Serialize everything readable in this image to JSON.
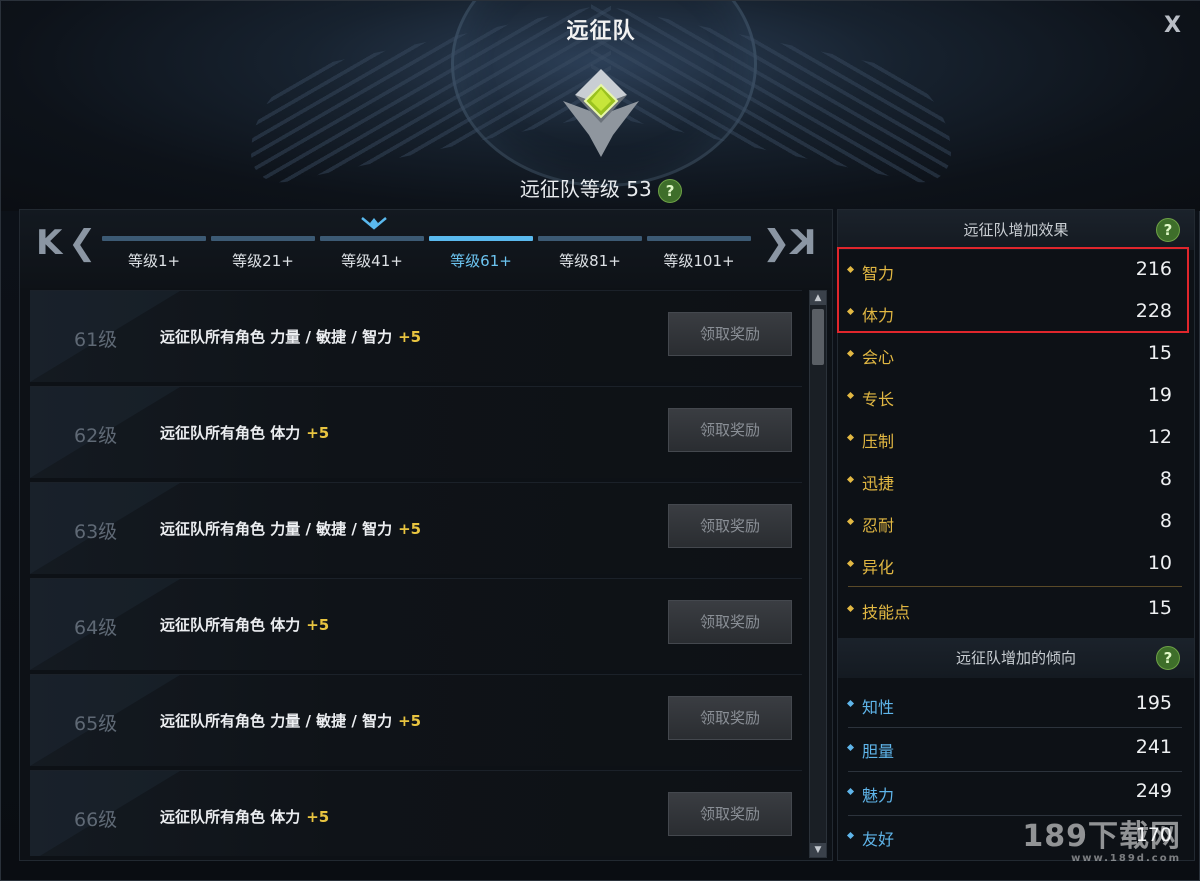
{
  "window": {
    "title": "远征队",
    "close_label": "X"
  },
  "expedition": {
    "level_label": "远征队等级 53",
    "help": "?"
  },
  "tabs": {
    "first": "K",
    "prev": "❮",
    "next": "❯",
    "last": "K",
    "items": [
      {
        "label": "等级1+",
        "active": false
      },
      {
        "label": "等级21+",
        "active": false
      },
      {
        "label": "等级41+",
        "active": false
      },
      {
        "label": "等级61+",
        "active": true
      },
      {
        "label": "等级81+",
        "active": false
      },
      {
        "label": "等级101+",
        "active": false
      }
    ]
  },
  "rewards": [
    {
      "level": "61级",
      "desc": "远征队所有角色 力量 / 敏捷 / 智力",
      "bonus": "+5",
      "button": "领取奖励"
    },
    {
      "level": "62级",
      "desc": "远征队所有角色 体力",
      "bonus": "+5",
      "button": "领取奖励"
    },
    {
      "level": "63级",
      "desc": "远征队所有角色 力量 / 敏捷 / 智力",
      "bonus": "+5",
      "button": "领取奖励"
    },
    {
      "level": "64级",
      "desc": "远征队所有角色 体力",
      "bonus": "+5",
      "button": "领取奖励"
    },
    {
      "level": "65级",
      "desc": "远征队所有角色 力量 / 敏捷 / 智力",
      "bonus": "+5",
      "button": "领取奖励"
    },
    {
      "level": "66级",
      "desc": "远征队所有角色 体力",
      "bonus": "+5",
      "button": "领取奖励"
    }
  ],
  "effects": {
    "title": "远征队增加效果",
    "help": "?",
    "stats": [
      {
        "name": "智力",
        "value": "216"
      },
      {
        "name": "体力",
        "value": "228"
      },
      {
        "name": "会心",
        "value": "15"
      },
      {
        "name": "专长",
        "value": "19"
      },
      {
        "name": "压制",
        "value": "12"
      },
      {
        "name": "迅捷",
        "value": "8"
      },
      {
        "name": "忍耐",
        "value": "8"
      },
      {
        "name": "异化",
        "value": "10"
      }
    ],
    "skill_points": {
      "name": "技能点",
      "value": "15"
    }
  },
  "tendencies": {
    "title": "远征队增加的倾向",
    "help": "?",
    "stats": [
      {
        "name": "知性",
        "value": "195"
      },
      {
        "name": "胆量",
        "value": "241"
      },
      {
        "name": "魅力",
        "value": "249"
      },
      {
        "name": "友好",
        "value": "170"
      }
    ]
  },
  "watermark": {
    "text": "189下载网",
    "url": "www.189d.com"
  },
  "colors": {
    "accent_blue": "#5ab9ee",
    "gold": "#e2b843",
    "highlight_red": "#e0262c",
    "help_green": "#3e6e2a"
  }
}
